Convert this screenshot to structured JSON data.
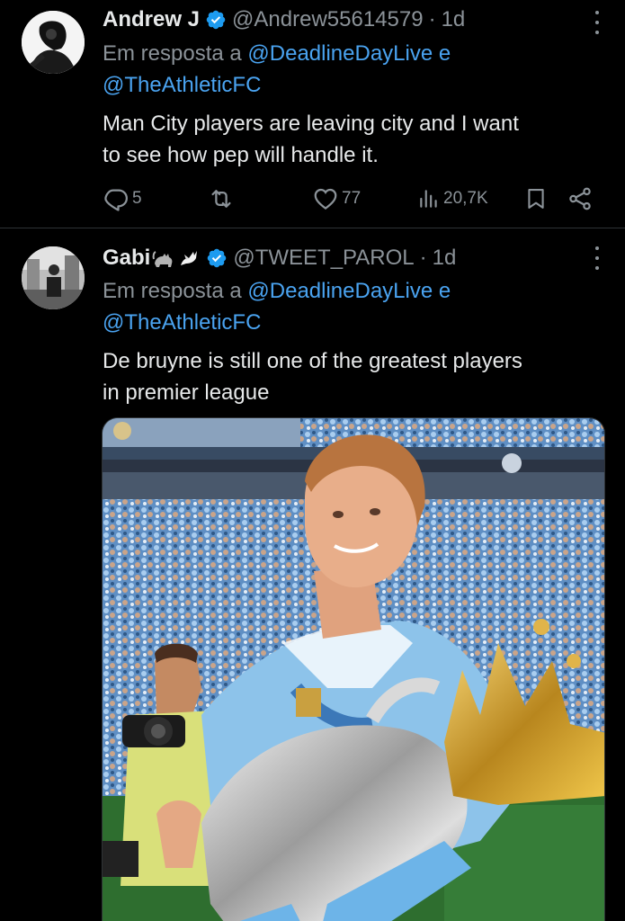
{
  "tweets": [
    {
      "author_name": "Andrew J",
      "handle": "@Andrew55614579",
      "separator": "·",
      "time": "1d",
      "reply_prefix": "Em resposta a",
      "reply_mention_1": "@DeadlineDayLive",
      "reply_conjunction": "e",
      "reply_mention_2": "@TheAthleticFC",
      "text_line_1": "Man City players are leaving city and I want",
      "text_line_2": "to see how pep will handle it.",
      "replies": "5",
      "retweets": "",
      "likes": "77",
      "views": "20,7K",
      "icons": [
        "verified-badge-icon",
        "more-icon",
        "reply-icon",
        "retweet-icon",
        "like-icon",
        "views-icon",
        "bookmark-icon",
        "share-icon"
      ]
    },
    {
      "author_name": "Gabi",
      "name_emojis": [
        "black-cat",
        "dove"
      ],
      "handle": "@TWEET_PAROL",
      "separator": "·",
      "time": "1d",
      "reply_prefix": "Em resposta a",
      "reply_mention_1": "@DeadlineDayLive",
      "reply_conjunction": "e",
      "reply_mention_2": "@TheAthleticFC",
      "text_line_1": "De bruyne is still one of the greatest players",
      "text_line_2": "in premier league",
      "media": "photo"
    }
  ],
  "colors": {
    "background": "#000000",
    "text": "#e7e9ea",
    "secondary": "#8b9298",
    "link": "#4aa3f0",
    "verified": "#1d9bf0"
  }
}
